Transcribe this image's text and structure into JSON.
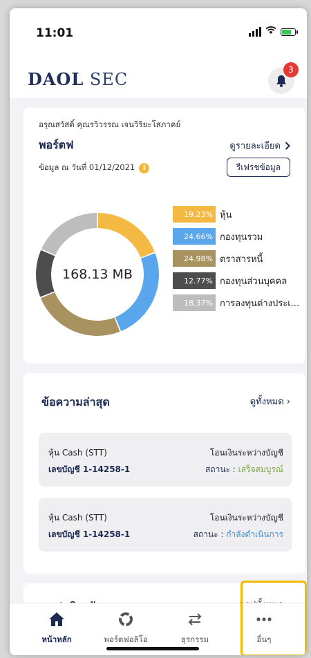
{
  "status_bar": {
    "time": "11:01",
    "battery_level": 0.7
  },
  "header": {
    "logo_part1": "DAOL",
    "logo_part2": "SEC",
    "notification_count": "3"
  },
  "portfolio": {
    "greeting": "อรุณสวัสดิ์ คุณรวิวรรณ เจนวิริยะโสภาคย์",
    "title": "พอร์ตฟ",
    "detail_link": "ดูรายละเอียด",
    "data_date": "ข้อมูล ณ วันที่ 01/12/2021",
    "refresh_label": "รีเฟรชข้อมูล",
    "total": "168.13 MB"
  },
  "chart_data": {
    "type": "pie",
    "categories": [
      "หุ้น",
      "กองทุนรวม",
      "ตราสารหนี้",
      "กองทุนส่วนบุคคล",
      "การลงทุนต่างประเ..."
    ],
    "values": [
      19.23,
      24.66,
      24.98,
      12.77,
      18.37
    ],
    "value_labels": [
      "19.23%",
      "24.66%",
      "24.98%",
      "12.77%",
      "18.37%"
    ],
    "colors": [
      "#f4b942",
      "#5aa6ec",
      "#a8925f",
      "#4d4d4d",
      "#bdbdbd"
    ],
    "center_label": "168.13 MB",
    "legend_position": "right"
  },
  "news": {
    "title": "ข้อความล่าสุด",
    "see_all": "ดูทั้งหมด",
    "items": [
      {
        "stock": "หุ้น Cash (STT)",
        "account": "เลขบัญชี 1-14258-1",
        "kind": "โอนเงินระหว่างบัญชี",
        "status_prefix": "สถานะ : ",
        "status_value": "เสร็จสมบูรณ์"
      },
      {
        "stock": "หุ้น Cash (STT)",
        "account": "เลขบัญชี 1-14258-1",
        "kind": "โอนเงินระหว่างบัญชี",
        "status_prefix": "สถานะ : ",
        "status_value": "กำลังดำเนินการ"
      }
    ]
  },
  "apps": {
    "title": "แอปพลิเคชันลงทุน",
    "see_all": "แอปทั้งหมด"
  },
  "tabbar": {
    "items": [
      {
        "label": "หน้าหลัก",
        "icon": "home-icon"
      },
      {
        "label": "พอร์ตฟอลิโอ",
        "icon": "portfolio-icon"
      },
      {
        "label": "ธุรกรรม",
        "icon": "transfer-icon"
      },
      {
        "label": "อื่นๆ",
        "icon": "more-icon"
      }
    ]
  }
}
